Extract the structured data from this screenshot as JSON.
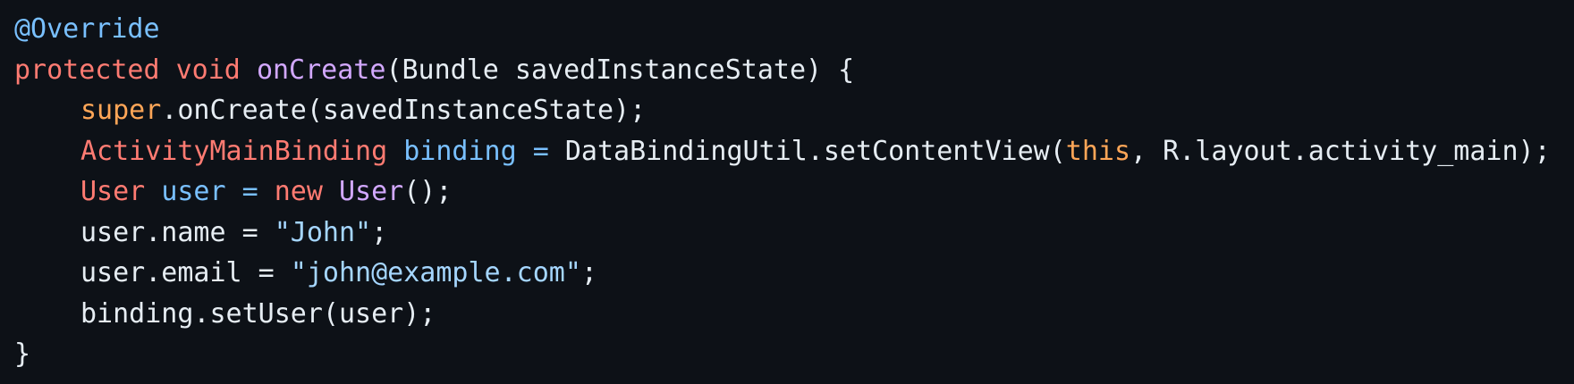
{
  "colors": {
    "background": "#0d1117",
    "plain": "#e6edf3",
    "annotation": "#79c0ff",
    "keyword": "#ff7b72",
    "function": "#d2a8ff",
    "super_this": "#ffa657",
    "variable": "#79c0ff",
    "string": "#a5d6ff"
  },
  "code": {
    "line1": {
      "annotation": "@Override"
    },
    "line2": {
      "kw_protected": "protected",
      "kw_void": "void",
      "method": "onCreate",
      "rest": "(Bundle savedInstanceState) {"
    },
    "line3": {
      "super": "super",
      "rest": ".onCreate(savedInstanceState);"
    },
    "line4": {
      "type": "ActivityMainBinding",
      "var": "binding",
      "op": "=",
      "call": "DataBindingUtil.setContentView(",
      "this": "this",
      "rest": ", R.layout.activity_main);"
    },
    "line5": {
      "type": "User",
      "var": "user",
      "op": "=",
      "kw_new": "new",
      "ctor": "User",
      "rest": "();"
    },
    "line6": {
      "lhs": "user.name = ",
      "str": "\"John\"",
      "end": ";"
    },
    "line7": {
      "lhs": "user.email = ",
      "str": "\"john@example.com\"",
      "end": ";"
    },
    "line8": {
      "text": "binding.setUser(user);"
    },
    "line9": {
      "text": "}"
    }
  }
}
